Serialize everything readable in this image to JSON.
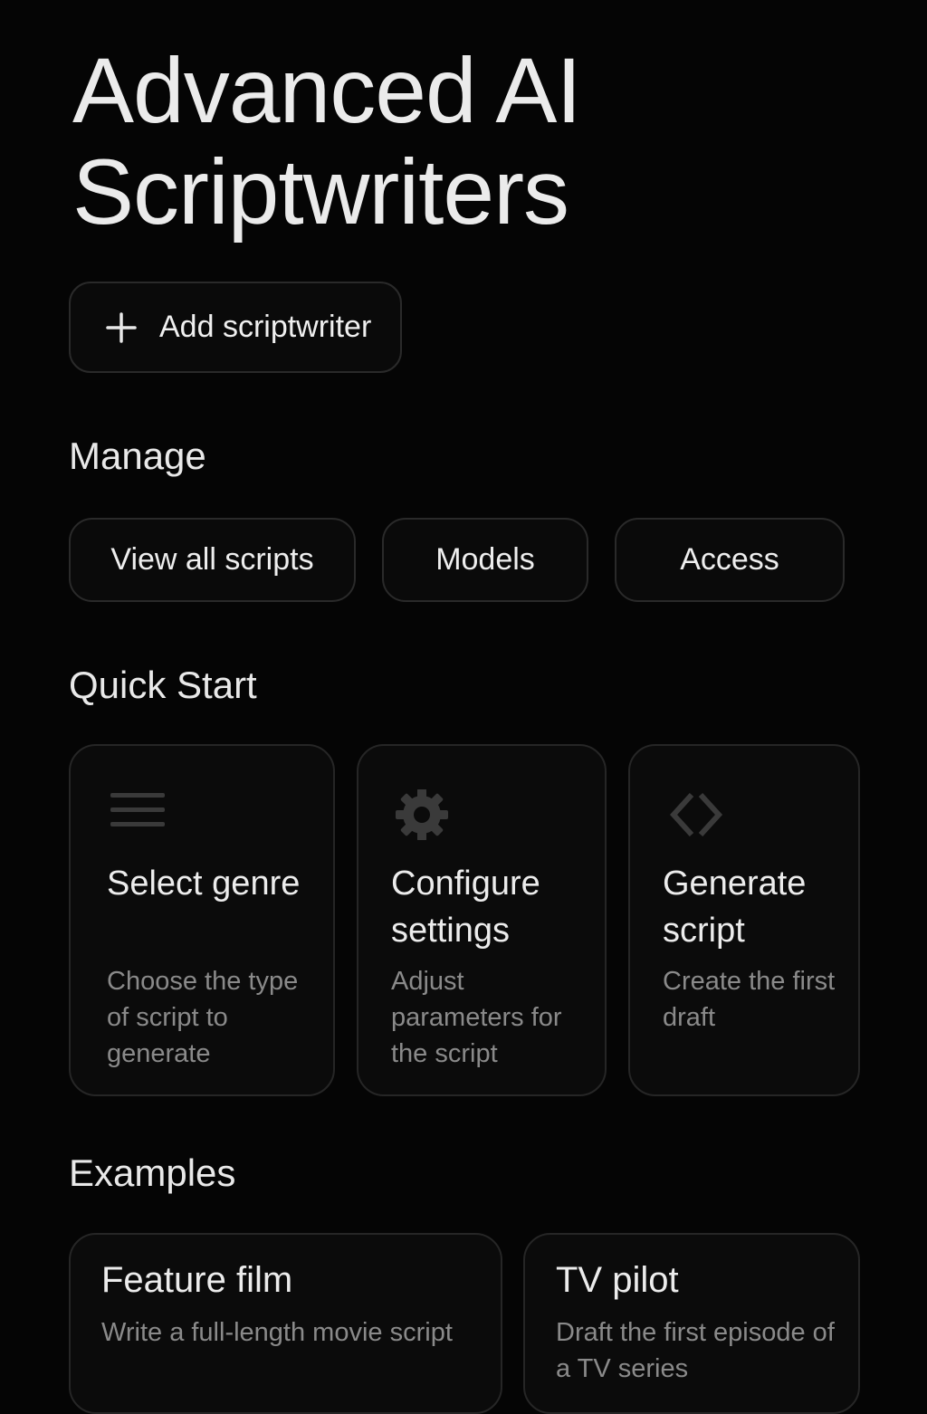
{
  "page": {
    "title_lines": [
      "Advanced AI",
      "Scriptwriters"
    ]
  },
  "add_button": {
    "label": "Add scriptwriter",
    "icon": "plus-icon"
  },
  "manage": {
    "heading": "Manage",
    "buttons": [
      {
        "label": "View all scripts"
      },
      {
        "label": "Models"
      },
      {
        "label": "Access"
      }
    ]
  },
  "quick_start": {
    "heading": "Quick Start",
    "cards": [
      {
        "icon": "list-icon",
        "title": "Select genre",
        "description": "Choose the type of script to generate"
      },
      {
        "icon": "gear-icon",
        "title": "Configure settings",
        "description": "Adjust parameters for the script"
      },
      {
        "icon": "code-icon",
        "title": "Generate script",
        "description": "Create the first draft"
      }
    ]
  },
  "examples": {
    "heading": "Examples",
    "cards": [
      {
        "title": "Feature film",
        "description": "Write a full-length movie script"
      },
      {
        "title": "TV pilot",
        "description": "Draft the first episode of a TV series"
      }
    ]
  },
  "colors": {
    "background": "#050505",
    "card_background": "#0b0b0b",
    "border": "#2a2a2a",
    "text": "#ececec",
    "muted_text": "#8a8a8a",
    "icon": "#3a3a3a"
  }
}
